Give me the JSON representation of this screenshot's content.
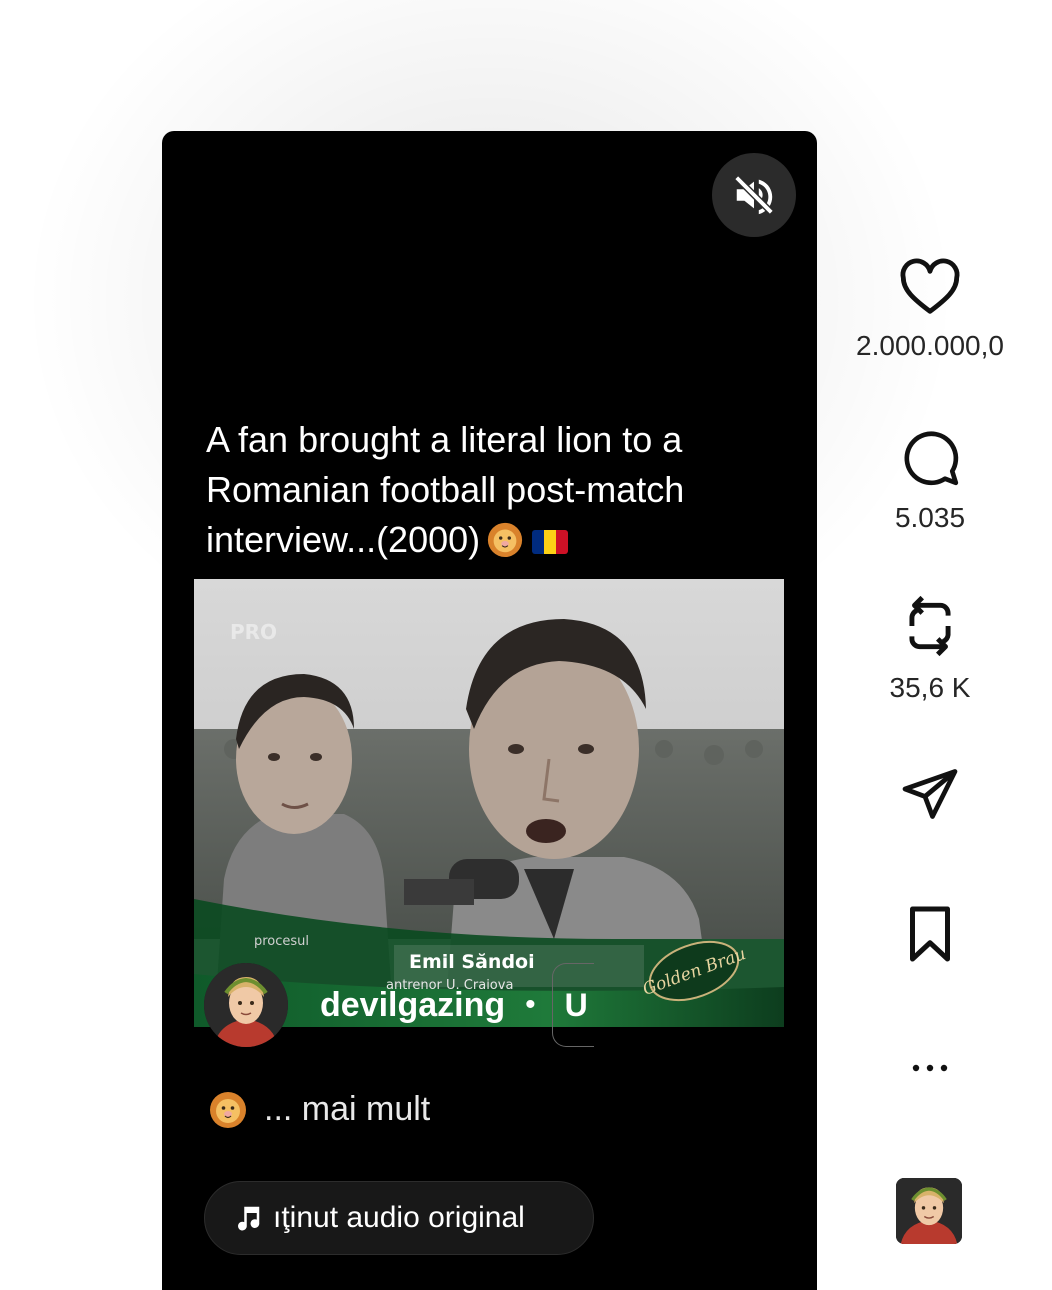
{
  "post": {
    "headline": "A fan brought a literal lion to a\nRomanian football post-match\ninterview...(2000)",
    "author": "devilgazing",
    "separator": "•",
    "follow_label": "U",
    "caption_more": "... mai mult",
    "audio_label": "ıţinut audio original"
  },
  "video_overlay": {
    "channel_logo": "PRO",
    "show_name": "procesul",
    "lower_third_name": "Emil Săndoi",
    "lower_third_role": "antrenor U. Craiova",
    "sponsor": "Golden Brau"
  },
  "actions": {
    "likes": "2.000.000,0",
    "comments": "5.035",
    "reposts": "35,6 K"
  },
  "icons": [
    "mute-icon",
    "heart-icon",
    "comment-icon",
    "repost-icon",
    "share-icon",
    "bookmark-icon",
    "more-icon",
    "music-note-icon",
    "lion-emoji",
    "romania-flag"
  ],
  "colors": {
    "reel_bg": "#000000",
    "page_bg": "#ffffff",
    "flag": [
      "#002B7F",
      "#FCD116",
      "#CE1126"
    ]
  }
}
